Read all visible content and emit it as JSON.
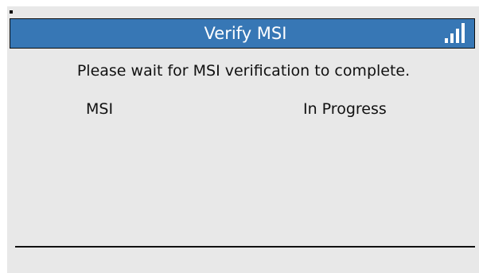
{
  "header": {
    "title": "Verify MSI",
    "signal_icon": "signal-strength-icon",
    "accent_color": "#3777b5"
  },
  "main": {
    "message": "Please wait for MSI verification to complete.",
    "status_row": {
      "label": "MSI",
      "value": "In Progress"
    }
  }
}
